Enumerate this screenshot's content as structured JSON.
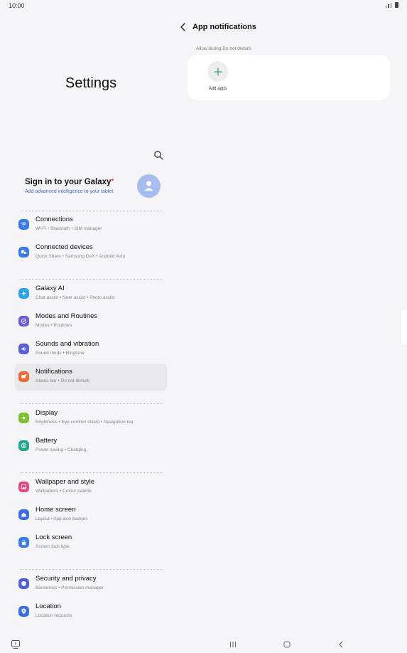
{
  "status": {
    "time": "10:00"
  },
  "left": {
    "title": "Settings",
    "account": {
      "title": "Sign in to your Galaxy",
      "marker": "*",
      "subtitle": "Add advanced intelligence to your tablet."
    },
    "items": [
      {
        "title": "Connections",
        "subtitle": "Wi-Fi  •  Bluetooth  •  SIM manager",
        "color": "#3b7be8",
        "icon": "wifi-icon"
      },
      {
        "title": "Connected devices",
        "subtitle": "Quick Share  •  Samsung DeX  •  Android Auto",
        "color": "#3b7be8",
        "icon": "devices-icon"
      },
      {
        "title": "Galaxy AI",
        "subtitle": "Chat assist  •  Note assist  •  Photo assist",
        "color": "#2fa4e7",
        "icon": "sparkle-icon"
      },
      {
        "title": "Modes and Routines",
        "subtitle": "Modes  •  Routines",
        "color": "#6a5bd6",
        "icon": "check-circle-icon"
      },
      {
        "title": "Sounds and vibration",
        "subtitle": "Sound mode  •  Ringtone",
        "color": "#5a5fd8",
        "icon": "speaker-icon"
      },
      {
        "title": "Notifications",
        "subtitle": "Status bar  •  Do not disturb",
        "color": "#ee6a34",
        "icon": "notification-icon"
      },
      {
        "title": "Display",
        "subtitle": "Brightness  •  Eye comfort shield  •  Navigation bar",
        "color": "#7fc02f",
        "icon": "sun-icon"
      },
      {
        "title": "Battery",
        "subtitle": "Power saving  •  Charging",
        "color": "#24a88e",
        "icon": "battery-icon"
      },
      {
        "title": "Wallpaper and style",
        "subtitle": "Wallpapers  •  Colour palette",
        "color": "#e2487a",
        "icon": "wallpaper-icon"
      },
      {
        "title": "Home screen",
        "subtitle": "Layout  •  App icon badges",
        "color": "#3b6fe0",
        "icon": "home-icon"
      },
      {
        "title": "Lock screen",
        "subtitle": "Screen lock type",
        "color": "#3b7be8",
        "icon": "lock-icon"
      },
      {
        "title": "Security and privacy",
        "subtitle": "Biometrics  •  Permission manager",
        "color": "#4c5fd8",
        "icon": "shield-icon"
      },
      {
        "title": "Location",
        "subtitle": "Location requests",
        "color": "#3b6fe0",
        "icon": "location-pin-icon"
      }
    ]
  },
  "right": {
    "title": "App notifications",
    "section_label": "Allow during Do not disturb",
    "add_label": "Add apps",
    "accent": "#2ea36a"
  }
}
